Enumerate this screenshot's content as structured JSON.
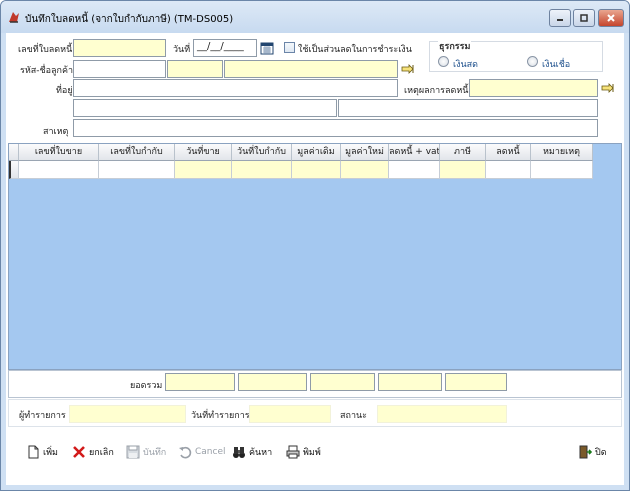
{
  "window": {
    "title": "บันทึกใบลดหนี้ (จากใบกำกับภาษี) (TM-DS005)"
  },
  "form": {
    "doc_no_label": "เลขที่ใบลดหนี้",
    "doc_no_value": "",
    "date_label": "วันที่",
    "date_value": "__/__/____",
    "checkbox_label": "ใช้เป็นส่วนลดในการชำระเงิน",
    "customer_label": "รหัส-ชื่อลูกค้า",
    "address_label": "ที่อยู่",
    "reason_label": "เหตุผลการลดหนี้",
    "cause_label": "สาเหตุ"
  },
  "transaction": {
    "label": "ธุรกรรม",
    "options": [
      "เงินสด",
      "เงินเชื่อ"
    ]
  },
  "grid": {
    "columns": [
      "เลขที่ใบขาย",
      "เลขที่ใบกำกับ",
      "วันที่ขาย",
      "วันที่ใบกำกับ",
      "มูลค่าเดิม",
      "มูลค่าใหม่",
      "ลดหนี้ + vat",
      "ภาษี",
      "ลดหนี้",
      "หมายเหตุ"
    ]
  },
  "totals": {
    "label": "ยอดรวม"
  },
  "info": {
    "user_label": "ผู้ทำรายการ",
    "date_label": "วันที่ทำรายการ",
    "status_label": "สถานะ"
  },
  "toolbar": {
    "add": "เพิ่ม",
    "cancel_doc": "ยกเลิก",
    "save": "บันทึก",
    "cancel": "Cancel",
    "search": "ค้นหา",
    "print": "พิมพ์",
    "close": "ปิด"
  },
  "colors": {
    "required_field": "#ffffd0",
    "grid_bg": "#a4c8f0",
    "titlebar": "#c7daf0"
  }
}
